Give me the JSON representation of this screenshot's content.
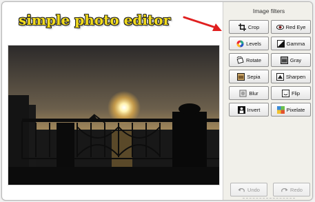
{
  "app": {
    "title": "simple photo editor"
  },
  "panel": {
    "title": "Image filters",
    "filters": [
      {
        "label": "Crop",
        "icon": "crop-icon"
      },
      {
        "label": "Red Eye",
        "icon": "eye-icon"
      },
      {
        "label": "Levels",
        "icon": "color-wheel-icon"
      },
      {
        "label": "Gamma",
        "icon": "gamma-icon"
      },
      {
        "label": "Rotate",
        "icon": "rotate-icon"
      },
      {
        "label": "Gray",
        "icon": "grayscale-icon"
      },
      {
        "label": "Sepia",
        "icon": "sepia-icon"
      },
      {
        "label": "Sharpen",
        "icon": "sharpen-icon"
      },
      {
        "label": "Blur",
        "icon": "blur-icon"
      },
      {
        "label": "Flip",
        "icon": "flip-icon"
      },
      {
        "label": "Invert",
        "icon": "invert-icon"
      },
      {
        "label": "Pixelate",
        "icon": "pixelate-icon"
      }
    ],
    "undo": "Undo",
    "redo": "Redo"
  },
  "colors": {
    "title_fill": "#f3dc1c",
    "arrow": "#e02020",
    "panel_bg": "#f1f0ea"
  }
}
